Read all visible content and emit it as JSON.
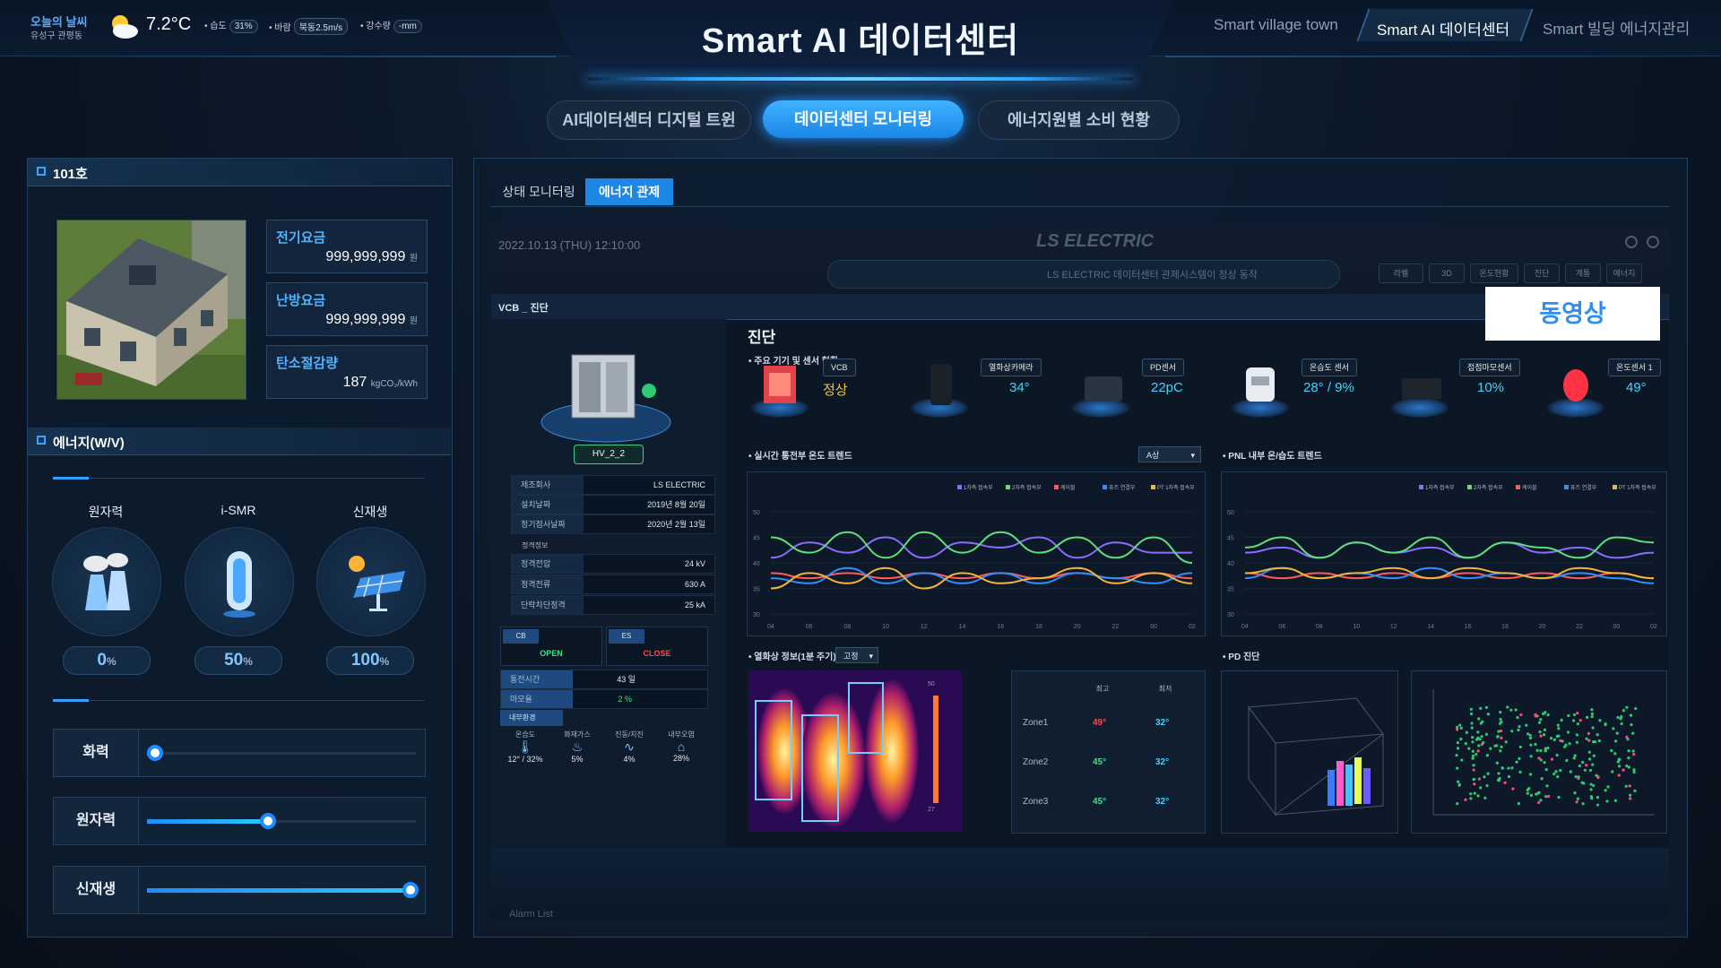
{
  "header": {
    "title": "Smart AI 데이터센터",
    "weather": {
      "label": "오늘의 날씨",
      "location": "유성구 관평동",
      "temperature": "7.2°C",
      "humidity_label": "• 습도",
      "humidity_value": "31%",
      "wind_label": "• 바람",
      "wind_value": "북동2.5m/s",
      "rain_label": "• 강수량",
      "rain_value": "-mm",
      "icon": "partly-cloudy-icon"
    },
    "nav": [
      {
        "label": "Smart village town",
        "active": false
      },
      {
        "label": "Smart AI 데이터센터",
        "active": true
      },
      {
        "label": "Smart 빌딩 에너지관리",
        "active": false
      }
    ]
  },
  "main_tabs": [
    {
      "label": "AI데이터센터 디지털 트윈",
      "active": false
    },
    {
      "label": "데이터센터 모니터링",
      "active": true
    },
    {
      "label": "에너지원별 소비 현황",
      "active": false
    }
  ],
  "room_panel": {
    "title": "101호",
    "fees": [
      {
        "label": "전기요금",
        "value": "999,999,999",
        "unit": "원"
      },
      {
        "label": "난방요금",
        "value": "999,999,999",
        "unit": "원"
      },
      {
        "label": "탄소절감량",
        "value": "187",
        "unit": "kgCO₂/kWh"
      }
    ]
  },
  "energy_panel": {
    "title": "에너지(W/V)",
    "sources": [
      {
        "name": "원자력",
        "icon": "nuclear-plant-icon",
        "percent": "0",
        "unit": "%"
      },
      {
        "name": "i-SMR",
        "icon": "smr-reactor-icon",
        "percent": "50",
        "unit": "%"
      },
      {
        "name": "신재생",
        "icon": "solar-panel-icon",
        "percent": "100",
        "unit": "%"
      }
    ],
    "sliders": [
      {
        "name": "화력",
        "level": 0.03
      },
      {
        "name": "원자력",
        "level": 0.45
      },
      {
        "name": "신재생",
        "level": 0.98
      }
    ]
  },
  "monitor": {
    "sub_tabs": [
      {
        "label": "상태 모니터링",
        "active": false
      },
      {
        "label": "에너지 관제",
        "active": true
      }
    ],
    "video_label": "동영상",
    "screen": {
      "datetime": "2022.10.13 (THU) 12:10:00",
      "brand": "LS ELECTRIC",
      "status_message": "LS ELECTRIC 데이터센터 관제시스템이 정상 동작",
      "toolbar": [
        "라벨",
        "3D",
        "온도현황",
        "진단",
        "계통",
        "에너지"
      ],
      "section_bar": "VCB _ 진단",
      "device_tag": "HV_2_2",
      "specs": [
        {
          "k": "제조회사",
          "v": "LS ELECTRIC"
        },
        {
          "k": "설치날짜",
          "v": "2019년 8월 20일"
        },
        {
          "k": "정기점사날짜",
          "v": "2020년 2월 13일"
        }
      ],
      "rating_title": "정격정보",
      "ratings": [
        {
          "k": "정격전압",
          "v": "24 kV"
        },
        {
          "k": "정격전류",
          "v": "630 A"
        },
        {
          "k": "단락차단정격",
          "v": "25 kA"
        }
      ],
      "cb": {
        "label": "CB",
        "state": "OPEN"
      },
      "es": {
        "label": "ES",
        "state": "CLOSE"
      },
      "ops": [
        {
          "k": "통전시간",
          "v": "43 일"
        },
        {
          "k": "마모율",
          "v": "2 %"
        }
      ],
      "env_title": "내부환경",
      "env": [
        {
          "k": "온습도",
          "v": "12° / 32%",
          "icon": "thermometer-icon"
        },
        {
          "k": "화재가스",
          "v": "5%",
          "icon": "flame-icon"
        },
        {
          "k": "진동/치진",
          "v": "4%",
          "icon": "pulse-icon"
        },
        {
          "k": "내부오염",
          "v": "28%",
          "icon": "house-icon"
        }
      ],
      "diag_title": "진단",
      "device_section": "주요 기기 및 센서 현황",
      "devices": [
        {
          "name": "VCB",
          "value": "정상"
        },
        {
          "name": "열화상카메라",
          "value": "34°"
        },
        {
          "name": "PD센서",
          "value": "22pC"
        },
        {
          "name": "온습도 센서",
          "value": "28° / 9%"
        },
        {
          "name": "접점마모센서",
          "value": "10%"
        },
        {
          "name": "온도센서 1",
          "value": "49°"
        }
      ],
      "trend_left_title": "실시간 통전부 온도 트렌드",
      "trend_left_select": "A상",
      "trend_right_title": "PNL 내부 온/습도 트렌드",
      "legend": [
        "1차측 접속부",
        "2차측 접속부",
        "케이블",
        "퓨즈 연결부",
        "PT 1차측 접속부"
      ],
      "thermal_title": "열화상 정보(1분 주기)",
      "thermal_select": "고정",
      "zone_headers": [
        "최고",
        "최저"
      ],
      "zones": [
        {
          "name": "Zone1",
          "max": "49°",
          "min": "32°"
        },
        {
          "name": "Zone2",
          "max": "45°",
          "min": "32°"
        },
        {
          "name": "Zone3",
          "max": "45°",
          "min": "32°"
        }
      ],
      "pd_title": "PD 진단",
      "alarm_label": "Alarm List"
    }
  },
  "chart_data": [
    {
      "type": "line",
      "title": "실시간 통전부 온도 트렌드",
      "x": [
        "04",
        "06",
        "08",
        "10",
        "12",
        "14",
        "16",
        "18",
        "20",
        "22",
        "00",
        "02"
      ],
      "ylim": [
        30,
        50
      ],
      "series": [
        {
          "name": "1차측 접속부",
          "values": [
            41,
            44,
            42,
            45,
            41,
            44,
            43,
            45,
            41,
            44,
            42,
            42
          ]
        },
        {
          "name": "2차측 접속부",
          "values": [
            45,
            42,
            46,
            41,
            46,
            42,
            46,
            42,
            45,
            41,
            45,
            40
          ]
        },
        {
          "name": "케이블",
          "values": [
            38,
            37,
            38,
            37,
            38,
            37,
            38,
            37,
            38,
            37,
            38,
            37
          ]
        },
        {
          "name": "퓨즈 연결부",
          "values": [
            37,
            36,
            39,
            36,
            38,
            36,
            38,
            36,
            38,
            37,
            36,
            38
          ]
        },
        {
          "name": "PT 1차측 접속부",
          "values": [
            35,
            38,
            36,
            39,
            35,
            38,
            36,
            37,
            39,
            36,
            38,
            36
          ]
        }
      ],
      "colors": [
        "#8a6cff",
        "#5ee07a",
        "#ff5b5b",
        "#2e8fff",
        "#f2b43a"
      ]
    },
    {
      "type": "line",
      "title": "PNL 내부 온/습도 트렌드",
      "x": [
        "04",
        "06",
        "08",
        "10",
        "12",
        "14",
        "16",
        "18",
        "20",
        "22",
        "00",
        "02"
      ],
      "ylim": [
        30,
        50
      ],
      "series": [
        {
          "name": "1차측 접속부",
          "values": [
            42,
            43,
            41,
            44,
            42,
            43,
            41,
            44,
            42,
            43,
            41,
            42
          ]
        },
        {
          "name": "2차측 접속부",
          "values": [
            43,
            45,
            41,
            44,
            42,
            45,
            41,
            44,
            43,
            41,
            45,
            44
          ]
        },
        {
          "name": "케이블",
          "values": [
            38,
            37,
            38,
            37,
            38,
            37,
            38,
            37,
            38,
            37,
            38,
            37
          ]
        },
        {
          "name": "퓨즈 연결부",
          "values": [
            37,
            39,
            37,
            38,
            37,
            39,
            37,
            38,
            37,
            38,
            37,
            36
          ]
        },
        {
          "name": "PT 1차측 접속부",
          "values": [
            38,
            39,
            37,
            38,
            39,
            37,
            39,
            38,
            37,
            39,
            38,
            37
          ]
        }
      ],
      "colors": [
        "#8a6cff",
        "#5ee07a",
        "#ff5b5b",
        "#2e8fff",
        "#f2b43a"
      ]
    }
  ]
}
